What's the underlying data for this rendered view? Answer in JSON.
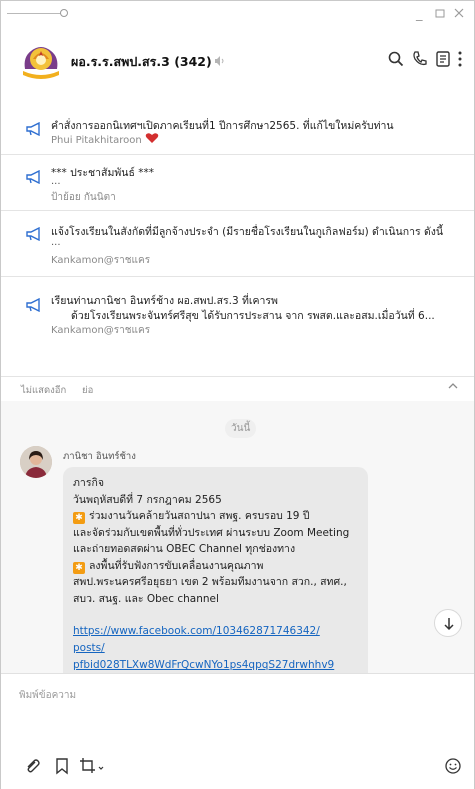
{
  "chat": {
    "title": "ผอ.ร.ร.สพป.สร.3 (342)"
  },
  "announcements": [
    {
      "title": "คำสั่งการออกนิเทศฯเปิดภาคเรียนที่1 ปีการศึกษา2565. ที่แก้ไขใหม่ครับท่าน",
      "dots": "",
      "author": "Phui Pitakhitaroon"
    },
    {
      "title": "*** ประชาสัมพันธ์ ***",
      "dots": "...",
      "author": "ป้าย้อย กันนิตา"
    },
    {
      "title": "แจ้งโรงเรียนในสังกัดที่มีลูกจ้างประจำ (มีรายชื่อโรงเรียนในกูเกิลฟอร์ม) ดำเนินการ ดังนี้",
      "dots": "...",
      "author": "Kankamon@ราชแคร"
    },
    {
      "title": "เรียนท่านภานิชา อินทร์ช้าง ผอ.สพป.สร.3 ที่เคารพ",
      "title2": "ด้วยโรงเรียนพระจันทร์ศรีสุข ได้รับการประสาน  จาก รพสต.และอสม.เมื่อวันที่ 6...",
      "dots": "",
      "author": "Kankamon@ราชแคร"
    }
  ],
  "collapse": {
    "hide": "ไม่แสดงอีก",
    "shrink": "ย่อ"
  },
  "messages": {
    "date": "วันนี้",
    "sender": "ภานิชา อินทร์ช้าง",
    "lines": [
      "ภารกิจ",
      "วันพฤหัสบดีที่ 7 กรกฎาคม 2565",
      "ร่วมงานวันคล้ายวันสถาปนา สพฐ. ครบรอบ 19 ปี",
      "และจัดร่วมกับเขตพื้นที่ทั่วประเทศ ผ่านระบบ Zoom Meeting",
      "และถ่ายทอดสดผ่าน OBEC Channel ทุกช่องทาง",
      "ลงพื้นที่รับฟังการขับเคลื่อนงานคุณภาพ",
      "สพป.พระนครศรีอยุธยา เขต 2 พร้อมทีมงานจาก สวก., สทศ.,",
      "สบว. สนฐ. และ Obec channel"
    ],
    "star_glyph": "✱",
    "links": [
      "https://www.facebook.com/103462871746342/",
      "posts/",
      "pfbid028TLXw8WdFrQcwNYo1ps4qpqS27drwhhv9"
    ]
  },
  "input": {
    "placeholder": "พิมพ์ข้อความ"
  },
  "colors": {
    "accent": "#1565c0",
    "heart": "#d32f2f",
    "star": "#f39c12"
  }
}
